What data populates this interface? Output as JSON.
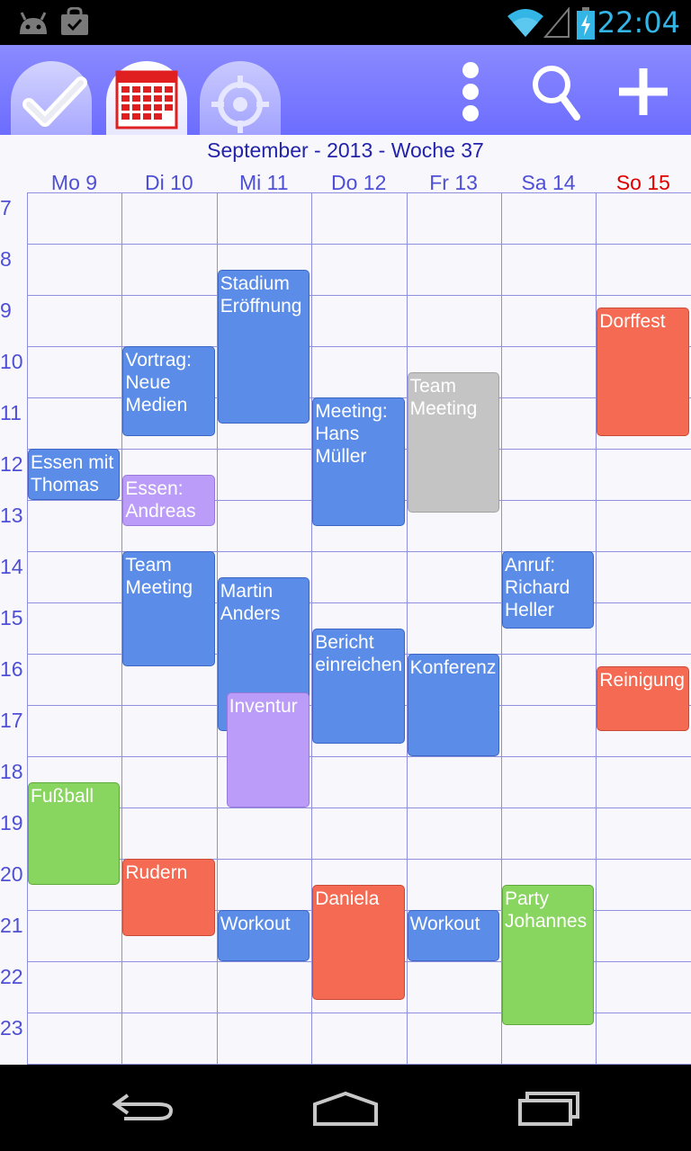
{
  "status_bar": {
    "time": "22:04",
    "icons": [
      "android-robot-icon",
      "shopping-bag-icon",
      "wifi-icon",
      "signal-icon",
      "battery-charging-icon"
    ]
  },
  "action_bar": {
    "tabs": [
      "checkmark-icon",
      "calendar-icon",
      "target-icon"
    ],
    "buttons": [
      "overflow-menu-icon",
      "search-icon",
      "add-icon"
    ]
  },
  "calendar": {
    "title": "September - 2013 - Woche 37",
    "days": [
      {
        "label": "Mo 9",
        "sunday": false
      },
      {
        "label": "Di 10",
        "sunday": false
      },
      {
        "label": "Mi 11",
        "sunday": false
      },
      {
        "label": "Do 12",
        "sunday": false
      },
      {
        "label": "Fr 13",
        "sunday": false
      },
      {
        "label": "Sa 14",
        "sunday": false
      },
      {
        "label": "So 15",
        "sunday": true
      }
    ],
    "hours": [
      "7",
      "8",
      "9",
      "10",
      "11",
      "12",
      "13",
      "14",
      "15",
      "16",
      "17",
      "18",
      "19",
      "20",
      "21",
      "22",
      "23"
    ],
    "events": [
      {
        "day": 0,
        "start": 12.0,
        "end": 13.0,
        "text": "Essen mit Thomas",
        "color": "blue"
      },
      {
        "day": 0,
        "start": 18.5,
        "end": 20.5,
        "text": "Fußball",
        "color": "green"
      },
      {
        "day": 1,
        "start": 10.0,
        "end": 11.75,
        "text": "Vortrag: Neue Medien",
        "color": "blue"
      },
      {
        "day": 1,
        "start": 12.5,
        "end": 13.5,
        "text": "Essen: Andreas",
        "color": "purple"
      },
      {
        "day": 1,
        "start": 14.0,
        "end": 16.25,
        "text": "Team Meeting",
        "color": "blue"
      },
      {
        "day": 1,
        "start": 20.0,
        "end": 21.5,
        "text": "Rudern",
        "color": "red"
      },
      {
        "day": 2,
        "start": 8.5,
        "end": 11.5,
        "text": "Stadium Eröffnung",
        "color": "blue"
      },
      {
        "day": 2,
        "start": 14.5,
        "end": 17.5,
        "text": "Martin Anders",
        "color": "blue"
      },
      {
        "day": 2,
        "start": 16.75,
        "end": 19.0,
        "text": "Inventur",
        "color": "purple",
        "offset": 10
      },
      {
        "day": 2,
        "start": 21.0,
        "end": 22.0,
        "text": "Workout",
        "color": "blue"
      },
      {
        "day": 3,
        "start": 11.0,
        "end": 13.5,
        "text": "Meeting: Hans Müller",
        "color": "blue"
      },
      {
        "day": 3,
        "start": 15.5,
        "end": 17.75,
        "text": "Bericht einreichen",
        "color": "blue"
      },
      {
        "day": 3,
        "start": 20.5,
        "end": 22.75,
        "text": "Daniela",
        "color": "red"
      },
      {
        "day": 4,
        "start": 10.5,
        "end": 13.25,
        "text": "Team Meeting",
        "color": "gray"
      },
      {
        "day": 4,
        "start": 16.0,
        "end": 18.0,
        "text": "Konferenz",
        "color": "blue"
      },
      {
        "day": 4,
        "start": 21.0,
        "end": 22.0,
        "text": "Workout",
        "color": "blue"
      },
      {
        "day": 5,
        "start": 14.0,
        "end": 15.5,
        "text": "Anruf: Richard Heller",
        "color": "blue"
      },
      {
        "day": 5,
        "start": 20.5,
        "end": 23.25,
        "text": "Party Johannes",
        "color": "green"
      },
      {
        "day": 6,
        "start": 9.25,
        "end": 11.75,
        "text": "Dorffest",
        "color": "red"
      },
      {
        "day": 6,
        "start": 16.25,
        "end": 17.5,
        "text": "Reinigung",
        "color": "red"
      }
    ]
  },
  "nav_bar": {
    "buttons": [
      "back-icon",
      "home-icon",
      "recent-apps-icon"
    ]
  }
}
